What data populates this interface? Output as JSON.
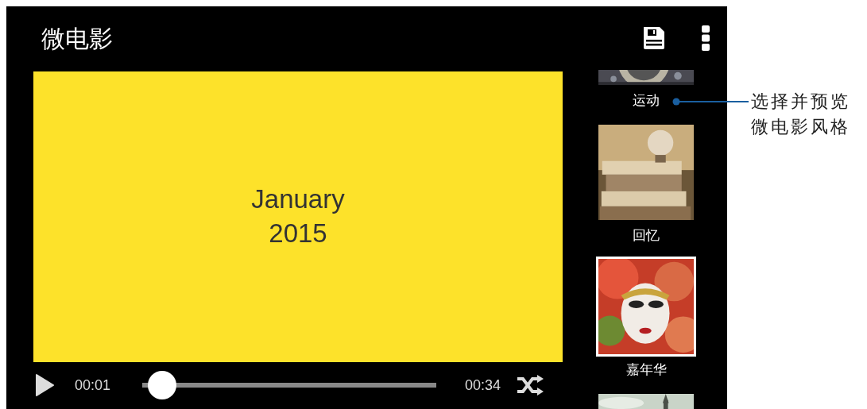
{
  "app_bar": {
    "title": "微电影"
  },
  "preview": {
    "title": "January",
    "subtitle": "2015"
  },
  "player": {
    "elapsed": "00:01",
    "total": "00:34",
    "level": 0.02
  },
  "styles": [
    {
      "label": "运动",
      "selected": false
    },
    {
      "label": "回忆",
      "selected": false
    },
    {
      "label": "嘉年华",
      "selected": true
    },
    {
      "selected": false
    }
  ],
  "callout": {
    "lines": [
      "选择并预览",
      "微电影风格"
    ]
  }
}
